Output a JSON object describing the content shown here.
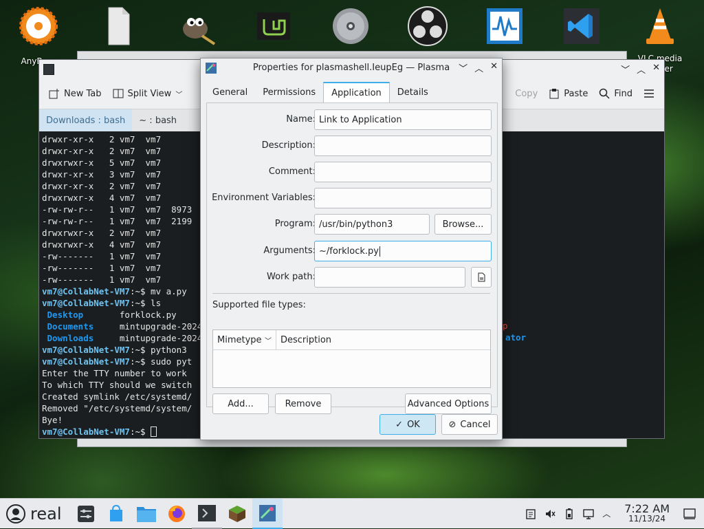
{
  "desktop_icons": [
    {
      "name": "anyburn",
      "label": "AnyBurn"
    },
    {
      "name": "file",
      "label": ""
    },
    {
      "name": "gimp",
      "label": ""
    },
    {
      "name": "mint-installer",
      "label": ""
    },
    {
      "name": "disc",
      "label": ""
    },
    {
      "name": "obs",
      "label": ""
    },
    {
      "name": "system-monitor",
      "label": ""
    },
    {
      "name": "vscode",
      "label": ""
    },
    {
      "name": "vlc",
      "label": "VLC media\nplayer"
    }
  ],
  "terminal": {
    "toolbar": {
      "new_tab": "New Tab",
      "split_view": "Split View",
      "copy": "Copy",
      "paste": "Paste",
      "find": "Find"
    },
    "tabs": [
      {
        "label": "Downloads : bash"
      },
      {
        "label": "~ : bash"
      }
    ],
    "listing": [
      "drwxr-xr-x   2 vm7  vm7",
      "drwxr-xr-x   2 vm7  vm7",
      "drwxrwxr-x   5 vm7  vm7",
      "drwxr-xr-x   3 vm7  vm7",
      "drwxr-xr-x   2 vm7  vm7",
      "drwxrwxr-x   4 vm7  vm7",
      "-rw-rw-r--   1 vm7  vm7  8973",
      "-rw-rw-r--   1 vm7  vm7  2199",
      "drwxrwxr-x   2 vm7  vm7",
      "drwxrwxr-x   4 vm7  vm7",
      "-rw-------   1 vm7  vm7",
      "-rw-------   1 vm7  vm7",
      "-rw-------   1 vm7  vm7"
    ],
    "prompt_user": "vm7@CollabNet-VM7",
    "prompt_path": ":~$",
    "cmd1": " mv a.py",
    "cmd2": " ls",
    "ls_col1": [
      "Desktop",
      "Documents",
      "Downloads"
    ],
    "ls_col2": [
      "forklock.py",
      "mintupgrade-2024",
      "mintupgrade-2024"
    ],
    "cmd3": " python3",
    "cmd4": " sudo pyt",
    "out1": "Enter the TTY number to work",
    "out2": "To which TTY should we switch",
    "out3": "Created symlink /etc/systemd/",
    "out4": "Removed \"/etc/systemd/system/",
    "out5": "Bye!",
    "right_frag1": "p",
    "right_frag2": "ator"
  },
  "dialog": {
    "title": "Properties for plasmashell.IeupEg — Plasma",
    "tabs": [
      "General",
      "Permissions",
      "Application",
      "Details"
    ],
    "active_tab": "Application",
    "labels": {
      "name": "Name:",
      "description": "Description:",
      "comment": "Comment:",
      "env": "Environment Variables:",
      "program": "Program:",
      "arguments": "Arguments:",
      "work_path": "Work path:",
      "supported": "Supported file types:"
    },
    "values": {
      "name": "Link to Application",
      "description": "",
      "comment": "",
      "env": "",
      "program": "/usr/bin/python3",
      "arguments": "~/forklock.py",
      "work_path": ""
    },
    "browse_label": "Browse...",
    "table_headers": {
      "mimetype": "Mimetype",
      "description": "Description"
    },
    "buttons": {
      "add": "Add...",
      "remove": "Remove",
      "advanced": "Advanced Options",
      "ok": "OK",
      "cancel": "Cancel"
    }
  },
  "taskbar": {
    "start_label": "real",
    "clock_time": "7:22 AM",
    "clock_date": "11/13/24"
  }
}
